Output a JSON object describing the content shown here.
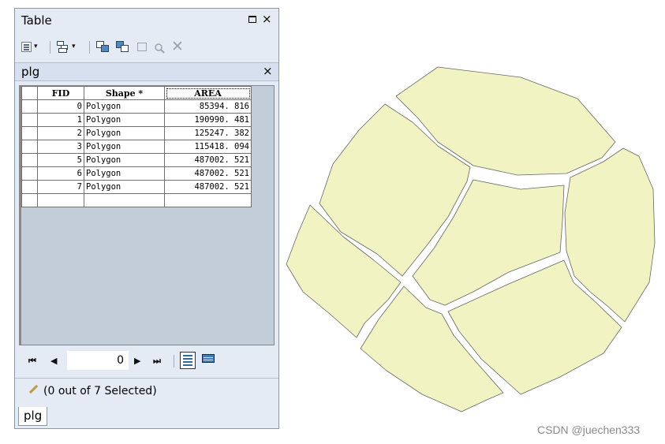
{
  "window": {
    "title": "Table",
    "restore_icon": "restore-icon",
    "close_glyph": "×"
  },
  "toolbar": {
    "icons": [
      "table-options-icon",
      "related-tables-icon",
      "select-by-attributes-icon",
      "switch-selection-icon",
      "clear-selection-icon",
      "zoom-to-selected-icon",
      "delete-selected-icon"
    ]
  },
  "table_tab": {
    "label": "plg",
    "close_glyph": "×"
  },
  "grid": {
    "columns": [
      {
        "key": "fid",
        "label": "FID"
      },
      {
        "key": "shape",
        "label": "Shape *"
      },
      {
        "key": "area",
        "label": "AREA"
      }
    ],
    "rows": [
      {
        "fid": "0",
        "shape": "Polygon",
        "area": "85394. 816"
      },
      {
        "fid": "1",
        "shape": "Polygon",
        "area": "190990. 481"
      },
      {
        "fid": "2",
        "shape": "Polygon",
        "area": "125247. 382"
      },
      {
        "fid": "3",
        "shape": "Polygon",
        "area": "115418. 094"
      },
      {
        "fid": "5",
        "shape": "Polygon",
        "area": "487002. 521"
      },
      {
        "fid": "6",
        "shape": "Polygon",
        "area": "487002. 521"
      },
      {
        "fid": "7",
        "shape": "Polygon",
        "area": "487002. 521"
      }
    ]
  },
  "navigator": {
    "first": "⏮",
    "prev": "◀",
    "record": "0",
    "next": "▶",
    "last": "⏭",
    "show_all_icon": "show-all-records-icon",
    "show_selected_icon": "show-selected-records-icon"
  },
  "status": {
    "text": "(0 out of 7 Selected)",
    "icon": "edit-pencil-icon"
  },
  "bottom_tab": {
    "label": "plg"
  },
  "map": {
    "fill": "#f2f3c3",
    "stroke": "#666666"
  },
  "watermark": "CSDN @juechen333",
  "colors": {
    "window_bg": "#e4ebf5",
    "grid_bg": "#c3cdd9",
    "polygon_fill": "#f2f3c3"
  }
}
